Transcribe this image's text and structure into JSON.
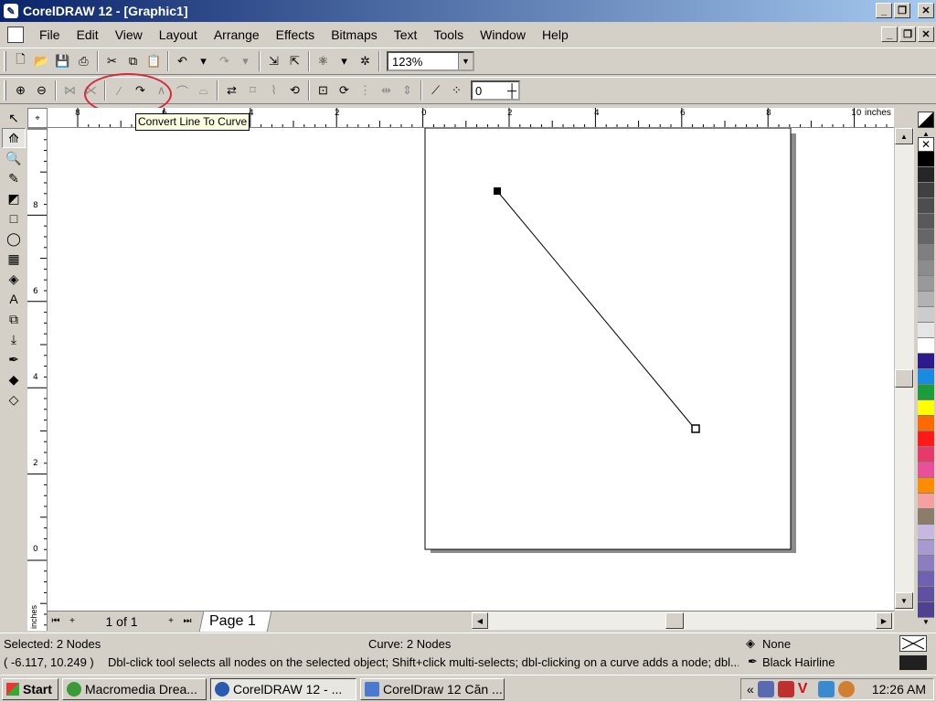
{
  "window": {
    "title": "CorelDRAW 12 - [Graphic1]",
    "min": "_",
    "max": "❐",
    "close": "✕"
  },
  "menu": [
    "File",
    "Edit",
    "View",
    "Layout",
    "Arrange",
    "Effects",
    "Bitmaps",
    "Text",
    "Tools",
    "Window",
    "Help"
  ],
  "toolbar": {
    "zoom": "123%",
    "nudge": "0"
  },
  "tooltip": "Convert Line To Curve",
  "ruler": {
    "units": "inches",
    "h_labels": [
      "8",
      "6",
      "4",
      "2",
      "0",
      "2",
      "4",
      "6",
      "8",
      "10"
    ],
    "v_labels": [
      "8",
      "6",
      "4",
      "2",
      "0"
    ]
  },
  "page_nav": {
    "count": "1 of 1",
    "page_tab": "Page 1"
  },
  "status": {
    "selection": "Selected: 2 Nodes",
    "curve": "Curve: 2 Nodes",
    "fill": "None",
    "coords": "( -6.117, 10.249 )",
    "hint": "Dbl-click tool selects all nodes on the selected object; Shift+click multi-selects; dbl-clicking on a curve adds a node; dbl...",
    "outline": "Black  Hairline"
  },
  "palette": [
    "#000000",
    "#262626",
    "#404040",
    "#4d4d4d",
    "#595959",
    "#666666",
    "#7f7f7f",
    "#8c8c8c",
    "#999999",
    "#b2b2b2",
    "#cccccc",
    "#e5e5e5",
    "#ffffff",
    "#2e1a8c",
    "#1a8ce0",
    "#1a9e3c",
    "#ffff00",
    "#ff6a00",
    "#ff1a1a",
    "#e83a6a",
    "#e8509a",
    "#ff8c00",
    "#f4a0a0",
    "#8c7d6a",
    "#c8b8e0",
    "#a89ad0",
    "#8c7dc0",
    "#7060b0",
    "#6050a0",
    "#504090"
  ],
  "taskbar": {
    "start": "Start",
    "tasks": [
      "Macromedia Drea...",
      "CorelDRAW 12 - ...",
      "CorelDraw 12 Căn ..."
    ],
    "clock": "12:26 AM"
  }
}
